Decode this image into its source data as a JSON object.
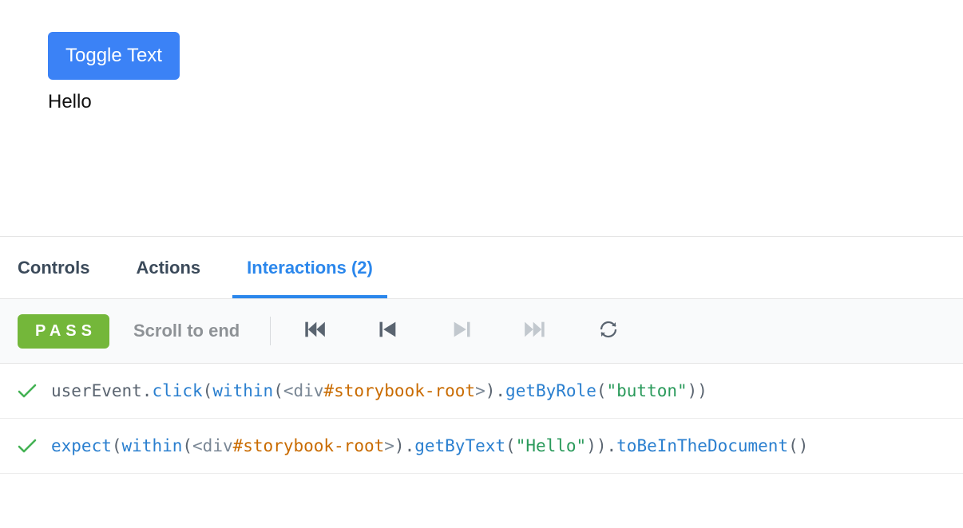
{
  "canvas": {
    "button_label": "Toggle Text",
    "text": "Hello"
  },
  "tabs": {
    "controls": "Controls",
    "actions": "Actions",
    "interactions_prefix": "Interactions",
    "interactions_count": "(2)"
  },
  "toolbar": {
    "status": "PASS",
    "scroll_label": "Scroll to end"
  },
  "rows": [
    {
      "tokens": [
        {
          "t": "userEvent",
          "c": "plain"
        },
        {
          "t": ".",
          "c": "plain"
        },
        {
          "t": "click",
          "c": "call"
        },
        {
          "t": "(",
          "c": "plain"
        },
        {
          "t": "within",
          "c": "call"
        },
        {
          "t": "(",
          "c": "plain"
        },
        {
          "t": "<div",
          "c": "tag"
        },
        {
          "t": "#storybook-root",
          "c": "hash"
        },
        {
          "t": ">",
          "c": "tag"
        },
        {
          "t": ")",
          "c": "plain"
        },
        {
          "t": ".",
          "c": "plain"
        },
        {
          "t": "getByRole",
          "c": "call"
        },
        {
          "t": "(",
          "c": "plain"
        },
        {
          "t": "\"button\"",
          "c": "str"
        },
        {
          "t": "))",
          "c": "plain"
        }
      ]
    },
    {
      "tokens": [
        {
          "t": "expect",
          "c": "call"
        },
        {
          "t": "(",
          "c": "plain"
        },
        {
          "t": "within",
          "c": "call"
        },
        {
          "t": "(",
          "c": "plain"
        },
        {
          "t": "<div",
          "c": "tag"
        },
        {
          "t": "#storybook-root",
          "c": "hash"
        },
        {
          "t": ">",
          "c": "tag"
        },
        {
          "t": ")",
          "c": "plain"
        },
        {
          "t": ".",
          "c": "plain"
        },
        {
          "t": "getByText",
          "c": "call"
        },
        {
          "t": "(",
          "c": "plain"
        },
        {
          "t": "\"Hello\"",
          "c": "str"
        },
        {
          "t": "))",
          "c": "plain"
        },
        {
          "t": ".",
          "c": "plain"
        },
        {
          "t": "toBeInTheDocument",
          "c": "call"
        },
        {
          "t": "()",
          "c": "plain"
        }
      ]
    }
  ]
}
